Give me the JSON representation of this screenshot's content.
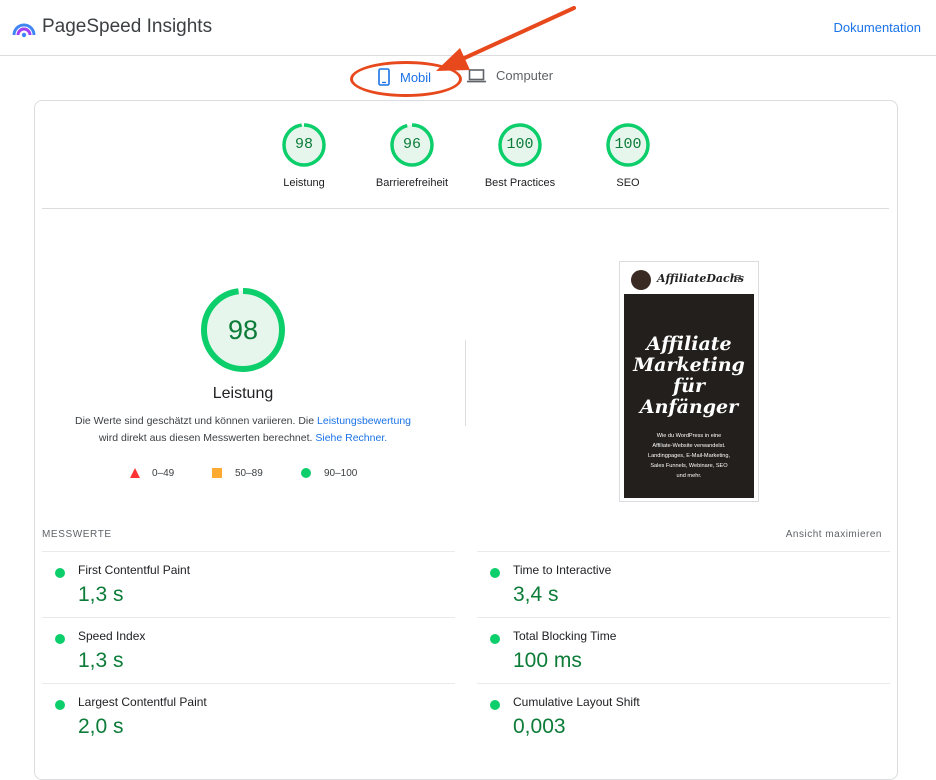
{
  "header": {
    "app_title": "PageSpeed Insights",
    "doc_link": "Dokumentation"
  },
  "tabs": [
    {
      "label": "Mobil",
      "icon": "smartphone-icon",
      "active": true
    },
    {
      "label": "Computer",
      "icon": "laptop-icon",
      "active": false
    }
  ],
  "categories": [
    {
      "score": "98",
      "label": "Leistung"
    },
    {
      "score": "96",
      "label": "Barrierefreiheit"
    },
    {
      "score": "100",
      "label": "Best Practices"
    },
    {
      "score": "100",
      "label": "SEO"
    }
  ],
  "performance": {
    "score": "98",
    "title": "Leistung",
    "desc_part1": "Die Werte sind geschätzt und können variieren. Die ",
    "desc_link1": "Leistungsbewertung",
    "desc_part2": "wird direkt aus diesen Messwerten berechnet. ",
    "desc_link2": "Siehe Rechner."
  },
  "legend": [
    {
      "range": "0–49",
      "shape": "triangle",
      "color": "#ff3333"
    },
    {
      "range": "50–89",
      "shape": "square",
      "color": "#ffaa33"
    },
    {
      "range": "90–100",
      "shape": "circle",
      "color": "#0cce6b"
    }
  ],
  "screenshot": {
    "brand": "AffiliateDachs",
    "menu_glyph": "≡",
    "hero_title_lines": [
      "Affiliate",
      "Marketing",
      "für",
      "Anfänger"
    ],
    "hero_text_lines": [
      "Wie du WordPress in eine",
      "Affiliate-Website verwandelst.",
      "Landingpages, E-Mail-Marketing,",
      "Sales Funnels, Webinare, SEO",
      "und mehr."
    ]
  },
  "metrics": {
    "section_title": "MESSWERTE",
    "expand_label": "Ansicht maximieren",
    "items": [
      {
        "name": "First Contentful Paint",
        "value": "1,3 s"
      },
      {
        "name": "Time to Interactive",
        "value": "3,4 s"
      },
      {
        "name": "Speed Index",
        "value": "1,3 s"
      },
      {
        "name": "Total Blocking Time",
        "value": "100 ms"
      },
      {
        "name": "Largest Contentful Paint",
        "value": "2,0 s"
      },
      {
        "name": "Cumulative Layout Shift",
        "value": "0,003"
      }
    ]
  },
  "colors": {
    "accent": "#1a73e8",
    "good": "#0cce6b",
    "good_text": "#0c7c38",
    "annotation": "#e8491c"
  }
}
